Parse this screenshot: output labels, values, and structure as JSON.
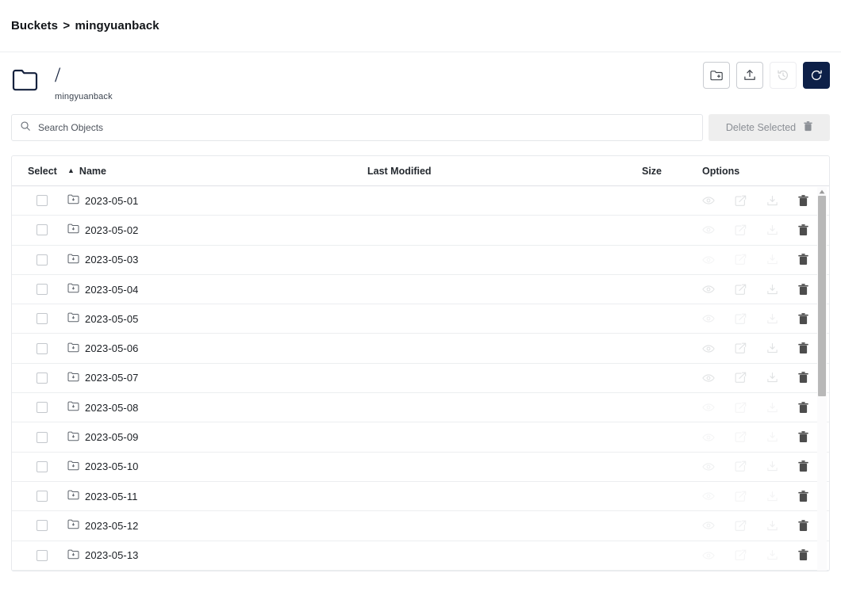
{
  "breadcrumb": {
    "root": "Buckets",
    "separator": ">",
    "current": "mingyuanback"
  },
  "object_header": {
    "icon": "folder-icon",
    "title": "/",
    "subtitle": "mingyuanback",
    "actions": [
      {
        "name": "create-new-path-button",
        "icon": "folder-plus-icon",
        "state": "enabled"
      },
      {
        "name": "upload-button",
        "icon": "upload-icon",
        "state": "enabled"
      },
      {
        "name": "rewind-button",
        "icon": "history-icon",
        "state": "disabled"
      },
      {
        "name": "refresh-button",
        "icon": "refresh-icon",
        "state": "primary"
      }
    ]
  },
  "search": {
    "icon": "search-icon",
    "placeholder": "Search Objects",
    "value": ""
  },
  "delete_selected": {
    "label": "Delete Selected",
    "icon": "trash-icon",
    "state": "disabled"
  },
  "table": {
    "columns": [
      {
        "key": "select",
        "label": "Select"
      },
      {
        "key": "name",
        "label": "Name",
        "sort": "asc",
        "sort_glyph": "▲"
      },
      {
        "key": "modified",
        "label": "Last Modified"
      },
      {
        "key": "size",
        "label": "Size"
      },
      {
        "key": "options",
        "label": "Options"
      }
    ],
    "row_icon": "folder-icon",
    "row_option_icons": [
      "preview-eye-icon",
      "share-icon",
      "download-icon",
      "delete-trash-icon"
    ],
    "rows": [
      {
        "selected": false,
        "name": "2023-05-01",
        "modified": "",
        "size": ""
      },
      {
        "selected": false,
        "name": "2023-05-02",
        "modified": "",
        "size": ""
      },
      {
        "selected": false,
        "name": "2023-05-03",
        "modified": "",
        "size": ""
      },
      {
        "selected": false,
        "name": "2023-05-04",
        "modified": "",
        "size": ""
      },
      {
        "selected": false,
        "name": "2023-05-05",
        "modified": "",
        "size": ""
      },
      {
        "selected": false,
        "name": "2023-05-06",
        "modified": "",
        "size": ""
      },
      {
        "selected": false,
        "name": "2023-05-07",
        "modified": "",
        "size": ""
      },
      {
        "selected": false,
        "name": "2023-05-08",
        "modified": "",
        "size": ""
      },
      {
        "selected": false,
        "name": "2023-05-09",
        "modified": "",
        "size": ""
      },
      {
        "selected": false,
        "name": "2023-05-10",
        "modified": "",
        "size": ""
      },
      {
        "selected": false,
        "name": "2023-05-11",
        "modified": "",
        "size": ""
      },
      {
        "selected": false,
        "name": "2023-05-12",
        "modified": "",
        "size": ""
      },
      {
        "selected": false,
        "name": "2023-05-13",
        "modified": "",
        "size": ""
      }
    ]
  },
  "scrollbar": {
    "up_arrow_glyph": "▲",
    "orientation": "vertical"
  },
  "colors": {
    "primary": "#0d2048",
    "title": "#14213d",
    "border": "#e7e9ec",
    "disabled_bg": "#eeeeee",
    "disabled_text": "#8b8f95"
  }
}
